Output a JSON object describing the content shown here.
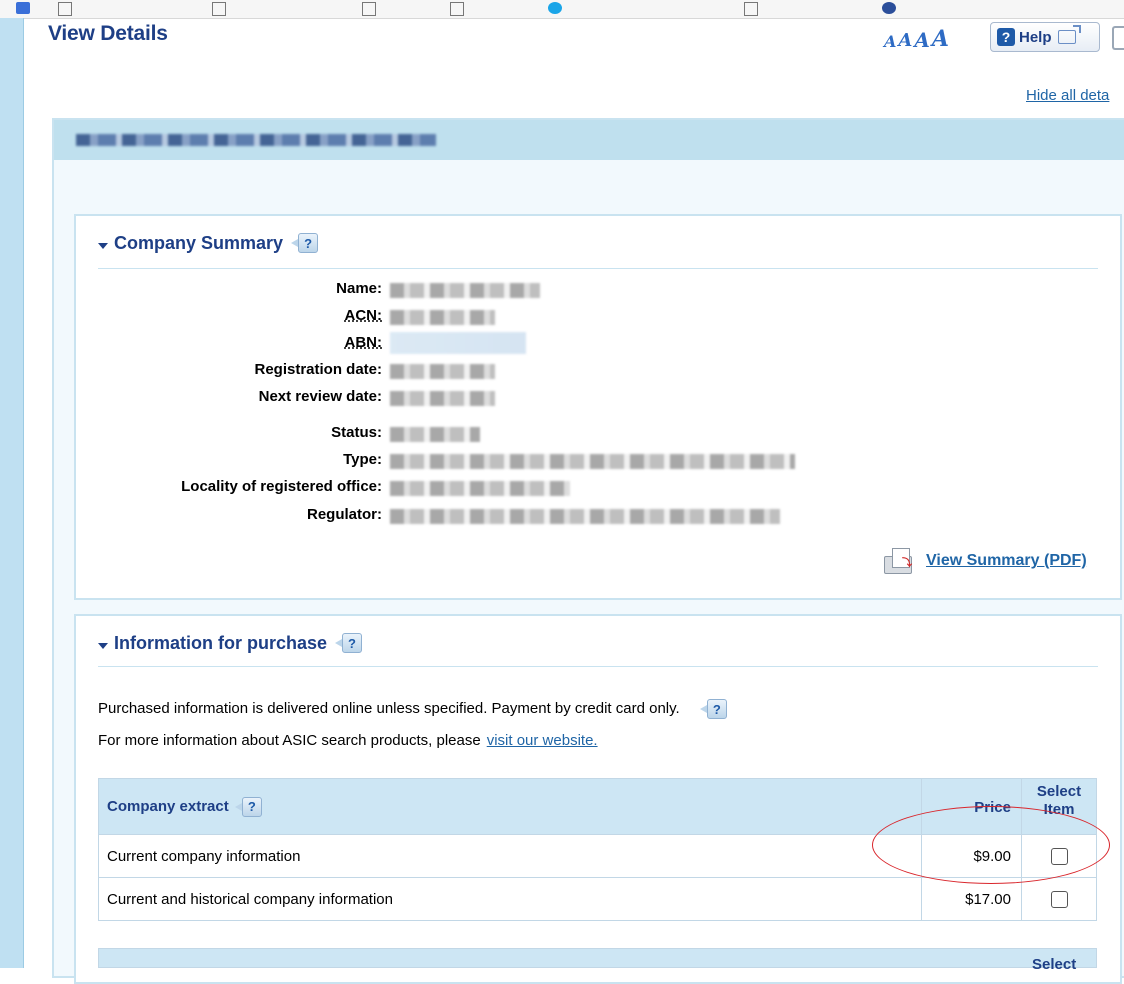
{
  "header": {
    "title": "View Details",
    "font_sizer_labels": [
      "A",
      "A",
      "A",
      "A"
    ],
    "help_label": "Help",
    "hide_all_label": "Hide all deta"
  },
  "company_summary": {
    "title": "Company Summary",
    "help_glyph": "?",
    "fields": [
      {
        "label": "Name:",
        "abbr": false
      },
      {
        "label": "ACN:",
        "abbr": true
      },
      {
        "label": "ABN:",
        "abbr": true
      },
      {
        "label": "Registration date:",
        "abbr": false
      },
      {
        "label": "Next review date:",
        "abbr": false
      },
      {
        "label": "Status:",
        "abbr": false
      },
      {
        "label": "Type:",
        "abbr": false
      },
      {
        "label": "Locality of registered office:",
        "abbr": false
      },
      {
        "label": "Regulator:",
        "abbr": false
      }
    ],
    "pdf_link_label": "View Summary (PDF)"
  },
  "purchase": {
    "title": "Information for purchase",
    "help_glyph": "?",
    "line1": "Purchased information is delivered online unless specified. Payment by credit card only.",
    "line2_prefix": "For more information about ASIC search products, please",
    "line2_link": "visit our website.",
    "table": {
      "header_product": "Company extract",
      "header_price": "Price",
      "header_select_1": "Select",
      "header_select_2": "Item",
      "rows": [
        {
          "name": "Current company information",
          "price": "$9.00",
          "selected": false
        },
        {
          "name": "Current and historical company information",
          "price": "$17.00",
          "selected": false
        }
      ]
    },
    "next_table_select": "Select"
  },
  "icons": [
    "help-question-icon",
    "external-window-icon",
    "print-icon",
    "collapse-arrow-icon",
    "pdf-printer-icon",
    "checkbox-icon"
  ],
  "colors": {
    "heading_blue": "#1e3f86",
    "link_blue": "#1f65a6",
    "panel_header": "#bfe0ee",
    "table_header": "#cde6f4",
    "annotation_red": "#d9262c"
  }
}
